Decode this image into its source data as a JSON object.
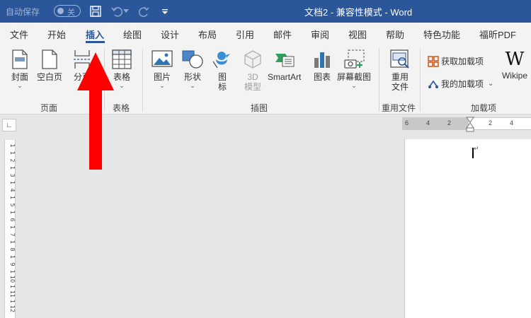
{
  "titlebar": {
    "autosave_label": "自动保存",
    "autosave_state": "关",
    "title": "文档2  -  兼容性模式  -  Word"
  },
  "tabs": [
    "文件",
    "开始",
    "插入",
    "绘图",
    "设计",
    "布局",
    "引用",
    "邮件",
    "审阅",
    "视图",
    "帮助",
    "特色功能",
    "福昕PDF"
  ],
  "active_tab": "插入",
  "ribbon": {
    "pages": {
      "cover": "封面",
      "blank": "空白页",
      "break": "分页",
      "group": "页面"
    },
    "tables": {
      "table": "表格",
      "group": "表格"
    },
    "illustrations": {
      "pictures": "图片",
      "shapes": "形状",
      "icons_line1": "图",
      "icons_line2": "标",
      "model3d_line1": "3D",
      "model3d_line2": "模型",
      "smartart": "SmartArt",
      "chart": "图表",
      "screenshot": "屏幕截图",
      "group": "插图"
    },
    "reuse": {
      "line1": "重用",
      "line2": "文件",
      "group": "重用文件"
    },
    "addins": {
      "get": "获取加载项",
      "mine": "我的加载项",
      "wiki": "Wikipe",
      "group": "加载项"
    }
  },
  "ruler": {
    "horizontal": [
      "6",
      "4",
      "2",
      "2",
      "4"
    ],
    "vertical": [
      "1",
      "1",
      "2",
      "1",
      "3",
      "1",
      "4",
      "1",
      "5",
      "1",
      "6",
      "1",
      "7",
      "1",
      "8",
      "1",
      "9",
      "1",
      "10",
      "1",
      "11",
      "1",
      "12"
    ]
  },
  "colors": {
    "accent": "#2b579a",
    "annotation": "#ff0000"
  }
}
